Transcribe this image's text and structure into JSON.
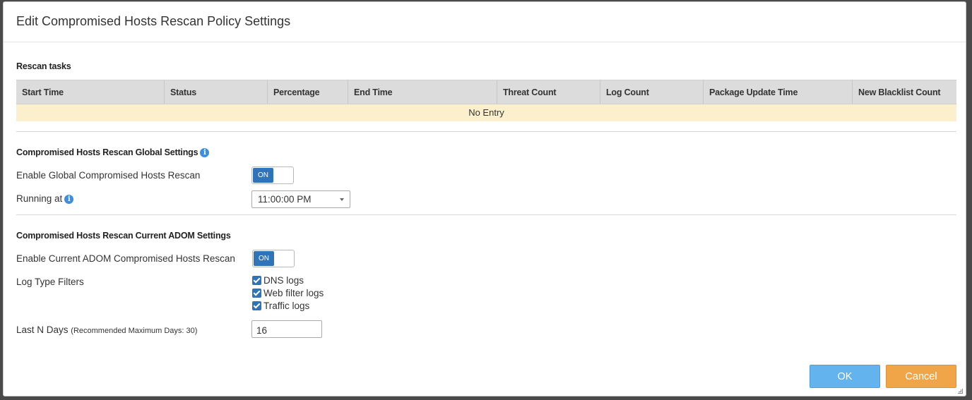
{
  "dialog": {
    "title": "Edit Compromised Hosts Rescan Policy Settings"
  },
  "rescan_tasks": {
    "title": "Rescan tasks",
    "columns": [
      "Start Time",
      "Status",
      "Percentage",
      "End Time",
      "Threat Count",
      "Log Count",
      "Package Update Time",
      "New Blacklist Count"
    ],
    "empty_text": "No Entry"
  },
  "global_settings": {
    "title": "Compromised Hosts Rescan Global Settings",
    "enable_label": "Enable Global Compromised Hosts Rescan",
    "enable_state": "ON",
    "running_at_label": "Running at",
    "running_at_value": "11:00:00 PM"
  },
  "adom_settings": {
    "title": "Compromised Hosts Rescan Current ADOM Settings",
    "enable_label": "Enable Current ADOM Compromised Hosts Rescan",
    "enable_state": "ON",
    "log_type_label": "Log Type Filters",
    "log_types": [
      {
        "label": "DNS logs",
        "checked": true
      },
      {
        "label": "Web filter logs",
        "checked": true
      },
      {
        "label": "Traffic logs",
        "checked": true
      }
    ],
    "last_n_days_label": "Last N Days",
    "last_n_days_hint": "(Recommended Maximum Days: 30)",
    "last_n_days_value": "16"
  },
  "buttons": {
    "ok": "OK",
    "cancel": "Cancel"
  },
  "colors": {
    "toggle_on": "#2f73b8",
    "ok_button": "#63b3ef",
    "cancel_button": "#f0a648",
    "empty_row": "#fcf0cc",
    "info_icon": "#3d8de0"
  }
}
